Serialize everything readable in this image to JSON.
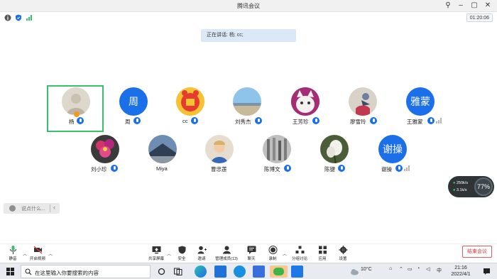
{
  "window": {
    "title": "腾讯会议",
    "timer": "01:20:06"
  },
  "speaking": {
    "text": "正在讲话: 杨; cc;"
  },
  "participants": [
    {
      "name": "杨",
      "avatar_text": "",
      "status": "active-speaker"
    },
    {
      "name": "周",
      "avatar_text": "周"
    },
    {
      "name": "cc",
      "avatar_text": ""
    },
    {
      "name": "刘秀杰",
      "avatar_text": ""
    },
    {
      "name": "王芳珍",
      "avatar_text": ""
    },
    {
      "name": "廖雪玲",
      "avatar_text": ""
    },
    {
      "name": "王雅蒙",
      "avatar_text": "雅蒙"
    },
    {
      "name": "刘小珍",
      "avatar_text": ""
    },
    {
      "name": "Miya",
      "avatar_text": ""
    },
    {
      "name": "曹忠莲",
      "avatar_text": ""
    },
    {
      "name": "陈博文",
      "avatar_text": ""
    },
    {
      "name": "陈键",
      "avatar_text": ""
    },
    {
      "name": "谢操",
      "avatar_text": "谢操"
    }
  ],
  "chat": {
    "placeholder": "说点什么..."
  },
  "network": {
    "upload": "250k/s",
    "download": "3.1k/s",
    "percent": "77%"
  },
  "toolbar": {
    "mute": "静音",
    "video": "开启视频",
    "share": "共享屏幕",
    "security": "安全",
    "invite": "邀请",
    "members": "管理成员(13)",
    "chat": "聊天",
    "record": "录制",
    "breakout": "分组讨论",
    "apps": "应用",
    "settings": "设置",
    "end": "结束会议"
  },
  "taskbar": {
    "search_placeholder": "在这里输入你要搜索的内容",
    "weather": "10°C",
    "ime": "中",
    "time": "21:16",
    "date": "2022/4/1"
  },
  "colors": {
    "accent": "#1b6fe8",
    "active_border": "#3bbf6f",
    "end_red": "#d93a3a"
  }
}
